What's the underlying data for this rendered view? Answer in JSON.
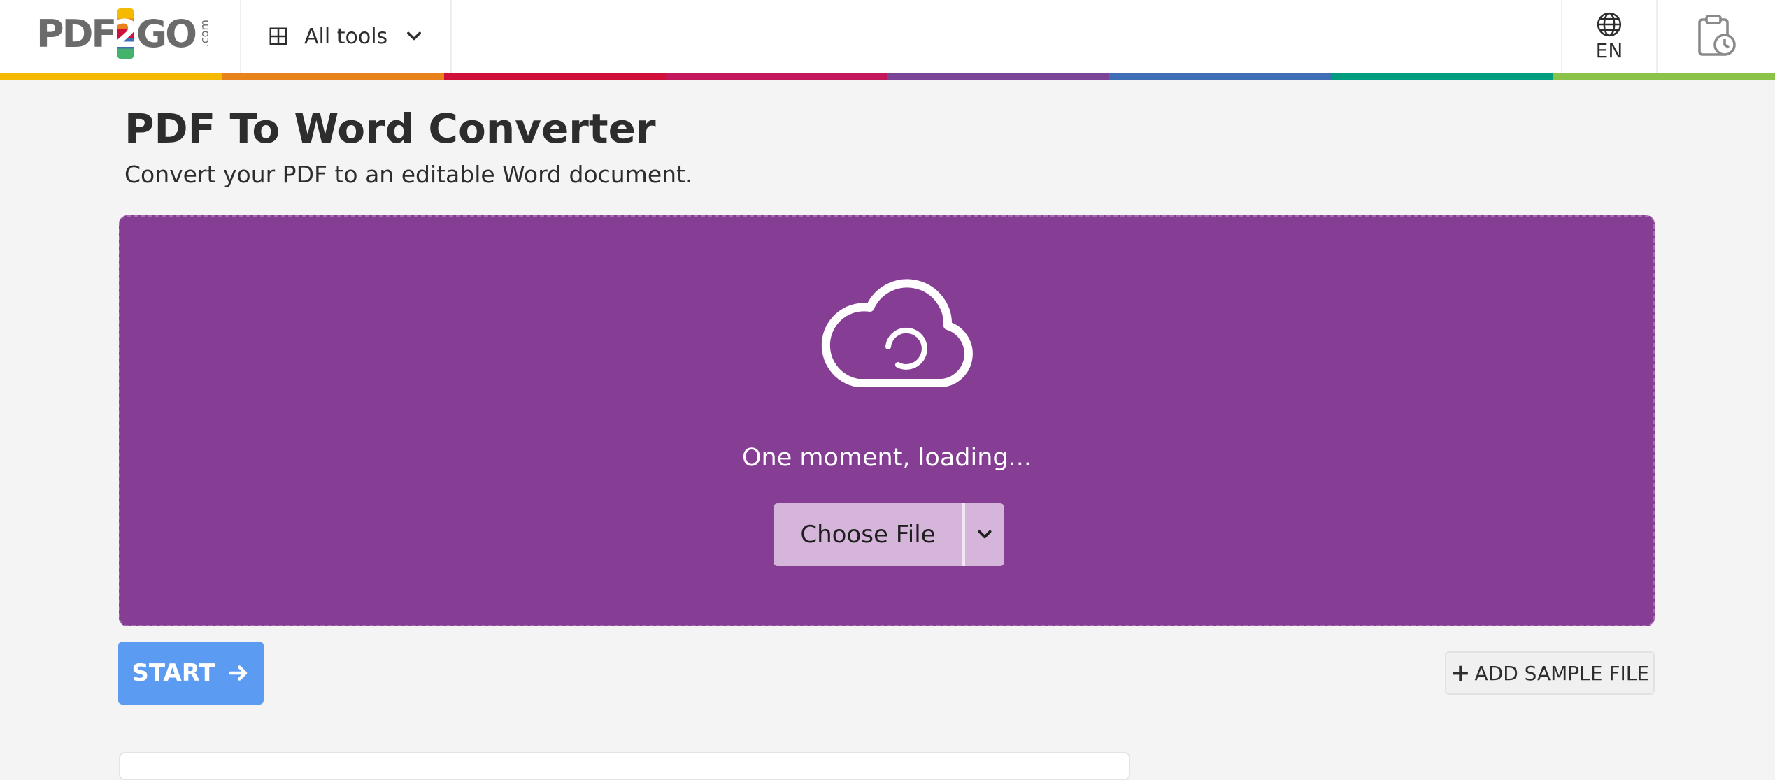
{
  "header": {
    "logo": {
      "left": "PDF",
      "middle": "2",
      "right": "GO",
      "suffix": ".com"
    },
    "all_tools_label": "All tools",
    "language_label": "EN",
    "icons": {
      "grid": "grid-icon",
      "chevron": "chevron-down-icon",
      "globe": "globe-icon",
      "history": "clipboard-clock-icon"
    },
    "color_stripes": [
      "#f5b900",
      "#e8831c",
      "#d0103a",
      "#c2185b",
      "#7b4497",
      "#3e6fb6",
      "#009e7f",
      "#8bc34a"
    ]
  },
  "page": {
    "title": "PDF To Word Converter",
    "subtitle": "Convert your PDF to an editable Word document."
  },
  "upload": {
    "status_text": "One moment, loading...",
    "choose_file_label": "Choose File",
    "background_color": "#863d94",
    "icons": {
      "cloud": "cloud-upload-icon",
      "dropdown": "chevron-down-icon"
    }
  },
  "actions": {
    "start_label": "START",
    "add_sample_label": "ADD SAMPLE FILE",
    "plus_symbol": "+",
    "start_color": "#5b9cf2"
  }
}
